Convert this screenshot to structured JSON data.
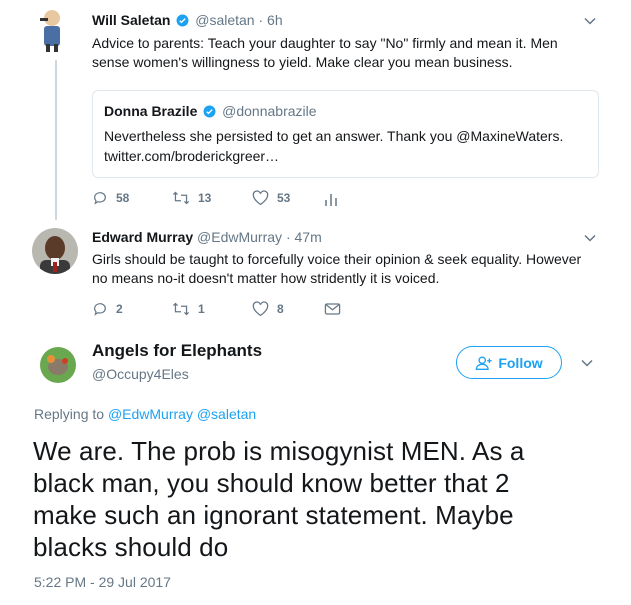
{
  "tweet1": {
    "name": "Will Saletan",
    "handle": "@saletan",
    "separator": "·",
    "time": "6h",
    "text_line1": "Advice to parents: Teach your daughter to say \"No\" firmly and mean it. Men",
    "text_line2": "sense women's willingness to yield. Make clear you mean business.",
    "quote": {
      "name": "Donna Brazile",
      "handle": "@donnabrazile",
      "text_line1": "Nevertheless she persisted to get an answer. Thank you @MaxineWaters.",
      "text_line2": "twitter.com/broderickgreer…"
    },
    "replies": "58",
    "retweets": "13",
    "likes": "53"
  },
  "tweet2": {
    "name": "Edward Murray",
    "handle": "@EdwMurray",
    "separator": "·",
    "time": "47m",
    "text_line1": "Girls should be taught to forcefully voice their opinion & seek equality. However",
    "text_line2": "no means no-it doesn't matter how stridently it is voiced.",
    "replies": "2",
    "retweets": "1",
    "likes": "8"
  },
  "main": {
    "name": "Angels for Elephants",
    "handle": "@Occupy4Eles",
    "follow_label": "Follow",
    "replying_prefix": "Replying to",
    "replying_to": "@EdwMurray @saletan",
    "text_line1": "We are. The prob is misogynist MEN. As a",
    "text_line2": "black man, you should know better that 2",
    "text_line3": "make such an ignorant statement. Maybe",
    "text_line4": "blacks should do",
    "timestamp": "5:22 PM - 29 Jul 2017"
  },
  "colors": {
    "accent": "#1da1f2",
    "secondary_text": "#657786",
    "border": "#e1e8ed"
  }
}
